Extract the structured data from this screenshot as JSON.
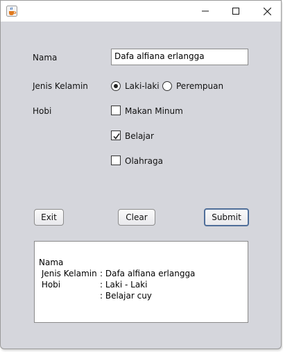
{
  "window": {
    "icon": "java-cup-icon"
  },
  "form": {
    "nama_label": "Nama",
    "nama_value": "Dafa alfiana erlangga",
    "jk_label": "Jenis Kelamin",
    "jk_options": [
      {
        "label": "Laki-laki",
        "selected": true
      },
      {
        "label": "Perempuan",
        "selected": false
      }
    ],
    "hobi_label": "Hobi",
    "hobi_options": [
      {
        "label": "Makan Minum",
        "checked": false
      },
      {
        "label": "Belajar",
        "checked": true
      },
      {
        "label": "Olahraga",
        "checked": false
      }
    ]
  },
  "buttons": {
    "exit": "Exit",
    "clear": "Clear",
    "submit": "Submit"
  },
  "output": {
    "lines": [
      {
        "key": "Nama",
        "value": ": Dafa alfiana erlangga"
      },
      {
        "key": " Jenis Kelamin",
        "value": ": Laki - Laki"
      },
      {
        "key": " Hobi",
        "value": ": Belajar cuy"
      }
    ]
  },
  "colors": {
    "window_bg": "#d5d6dc",
    "default_button_border": "#4f6e99"
  }
}
